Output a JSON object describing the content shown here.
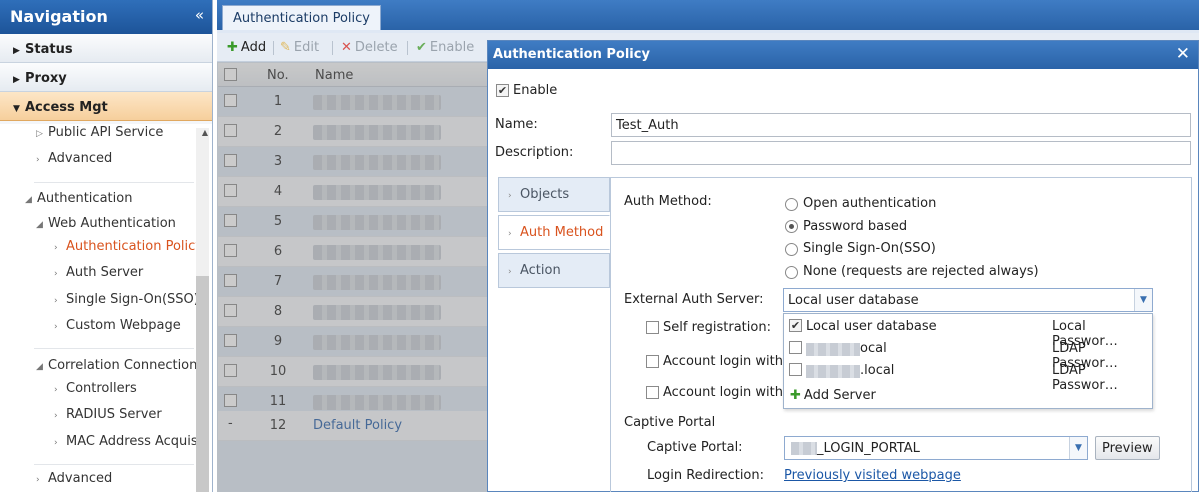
{
  "nav": {
    "title": "Navigation",
    "collapse_glyph": "«",
    "sections": [
      {
        "label": "Status",
        "expanded": false
      },
      {
        "label": "Proxy",
        "expanded": false
      },
      {
        "label": "Access Mgt",
        "expanded": true
      }
    ],
    "tree": {
      "public_api": "Public API Service",
      "advanced_top": "Advanced",
      "authentication": "Authentication",
      "web_authentication": "Web Authentication",
      "authentication_policy": "Authentication Policy",
      "auth_server": "Auth Server",
      "sso": "Single Sign-On(SSO)",
      "custom_webpage": "Custom Webpage",
      "correlation_connection": "Correlation Connection",
      "controllers": "Controllers",
      "radius_server": "RADIUS Server",
      "mac_address": "MAC Address Acquisi",
      "advanced_bottom": "Advanced"
    }
  },
  "tabs": [
    "Authentication Policy"
  ],
  "toolbar": {
    "add": "Add",
    "edit": "Edit",
    "delete": "Delete",
    "enable": "Enable"
  },
  "grid": {
    "columns": [
      "No.",
      "Name"
    ],
    "rows": [
      {
        "no": "1",
        "name": ""
      },
      {
        "no": "2",
        "name": ""
      },
      {
        "no": "3",
        "name": ""
      },
      {
        "no": "4",
        "name": ""
      },
      {
        "no": "5",
        "name": ""
      },
      {
        "no": "6",
        "name": ""
      },
      {
        "no": "7",
        "name": ""
      },
      {
        "no": "8",
        "name": ""
      },
      {
        "no": "9",
        "name": ""
      },
      {
        "no": "10",
        "name": ""
      },
      {
        "no": "11",
        "name": ""
      },
      {
        "no": "12",
        "name": "Default Policy",
        "checkbox_glyph": "-"
      }
    ]
  },
  "dialog": {
    "title": "Authentication Policy",
    "close_glyph": "✕",
    "enable_label": "Enable",
    "enable_checked": true,
    "name_label": "Name:",
    "name_value": "Test_Auth",
    "description_label": "Description:",
    "description_value": "",
    "side_tabs": [
      {
        "label": "Objects",
        "active": false
      },
      {
        "label": "Auth Method",
        "active": true
      },
      {
        "label": "Action",
        "active": false
      }
    ],
    "auth_method_label": "Auth Method:",
    "auth_methods": [
      {
        "label": "Open authentication",
        "selected": false
      },
      {
        "label": "Password based",
        "selected": true
      },
      {
        "label": "Single Sign-On(SSO)",
        "selected": false
      },
      {
        "label": "None (requests are rejected always)",
        "selected": false
      }
    ],
    "external_auth_label": "External Auth Server:",
    "external_auth_value": "Local user database",
    "self_registration_label": "Self registration:",
    "account_login_1": "Account login with W",
    "account_login_2": "Account login with S",
    "dropdown": {
      "options": [
        {
          "name": "Local user database",
          "type": "Local Passwor…",
          "checked": true
        },
        {
          "name": "ocal",
          "type": "LDAP Passwor…",
          "checked": false
        },
        {
          "name": ".local",
          "type": "LDAP Passwor…",
          "checked": false
        }
      ],
      "add_label": "Add Server"
    },
    "captive_portal_section": "Captive Portal",
    "captive_portal_label": "Captive Portal:",
    "captive_portal_value": "_LOGIN_PORTAL",
    "preview_label": "Preview",
    "login_redirection_label": "Login Redirection:",
    "login_redirection_value": "Previously visited webpage"
  },
  "colors": {
    "accent": "#2a63a8",
    "selected_item": "#d9531e",
    "link": "#1b57a6",
    "add_green": "#3a9a2a"
  }
}
